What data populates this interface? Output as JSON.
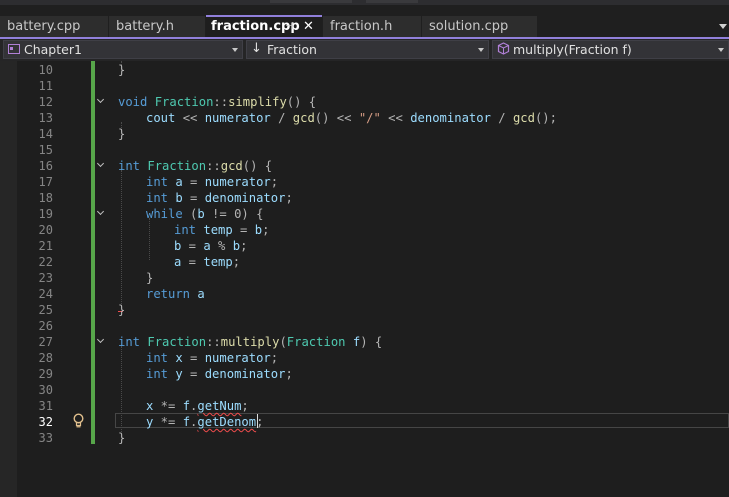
{
  "tabs": [
    {
      "label": "battery.cpp",
      "active": false
    },
    {
      "label": "battery.h",
      "active": false
    },
    {
      "label": "fraction.cpp",
      "active": true,
      "pin_icon": "pin-icon",
      "close_icon": "close-icon"
    },
    {
      "label": "fraction.h",
      "active": false
    },
    {
      "label": "solution.cpp",
      "active": false
    }
  ],
  "nav": {
    "project": "Chapter1",
    "scope": "Fraction",
    "member": "multiply(Fraction f)"
  },
  "editor": {
    "current_line": "32",
    "lines": [
      {
        "n": "10",
        "tokens": [
          {
            "t": "}",
            "c": "op"
          }
        ]
      },
      {
        "n": "11",
        "tokens": []
      },
      {
        "n": "12",
        "tokens": [
          {
            "t": "void",
            "c": "kw"
          },
          {
            "t": " ",
            "c": ""
          },
          {
            "t": "Fraction",
            "c": "cls"
          },
          {
            "t": "::",
            "c": "op"
          },
          {
            "t": "simplify",
            "c": "fn"
          },
          {
            "t": "() {",
            "c": "op"
          }
        ]
      },
      {
        "n": "13",
        "tokens": [
          {
            "t": "cout",
            "c": "var"
          },
          {
            "t": " << ",
            "c": "op"
          },
          {
            "t": "numerator",
            "c": "var"
          },
          {
            "t": " / ",
            "c": "op"
          },
          {
            "t": "gcd",
            "c": "fn"
          },
          {
            "t": "() << ",
            "c": "op"
          },
          {
            "t": "\"/\"",
            "c": "str"
          },
          {
            "t": " << ",
            "c": "op"
          },
          {
            "t": "denominator",
            "c": "var"
          },
          {
            "t": " / ",
            "c": "op"
          },
          {
            "t": "gcd",
            "c": "fn"
          },
          {
            "t": "();",
            "c": "op"
          }
        ]
      },
      {
        "n": "14",
        "tokens": [
          {
            "t": "}",
            "c": "op"
          }
        ]
      },
      {
        "n": "15",
        "tokens": []
      },
      {
        "n": "16",
        "tokens": [
          {
            "t": "int",
            "c": "kw"
          },
          {
            "t": " ",
            "c": ""
          },
          {
            "t": "Fraction",
            "c": "cls"
          },
          {
            "t": "::",
            "c": "op"
          },
          {
            "t": "gcd",
            "c": "fn"
          },
          {
            "t": "() {",
            "c": "op"
          }
        ]
      },
      {
        "n": "17",
        "tokens": [
          {
            "t": "int",
            "c": "kw"
          },
          {
            "t": " ",
            "c": ""
          },
          {
            "t": "a",
            "c": "var"
          },
          {
            "t": " = ",
            "c": "op"
          },
          {
            "t": "numerator",
            "c": "var"
          },
          {
            "t": ";",
            "c": "op"
          }
        ]
      },
      {
        "n": "18",
        "tokens": [
          {
            "t": "int",
            "c": "kw"
          },
          {
            "t": " ",
            "c": ""
          },
          {
            "t": "b",
            "c": "var"
          },
          {
            "t": " = ",
            "c": "op"
          },
          {
            "t": "denominator",
            "c": "var"
          },
          {
            "t": ";",
            "c": "op"
          }
        ]
      },
      {
        "n": "19",
        "tokens": [
          {
            "t": "while",
            "c": "kw"
          },
          {
            "t": " (",
            "c": "op"
          },
          {
            "t": "b",
            "c": "var"
          },
          {
            "t": " != 0) {",
            "c": "op"
          }
        ]
      },
      {
        "n": "20",
        "tokens": [
          {
            "t": "int",
            "c": "kw"
          },
          {
            "t": " ",
            "c": ""
          },
          {
            "t": "temp",
            "c": "var"
          },
          {
            "t": " = ",
            "c": "op"
          },
          {
            "t": "b",
            "c": "var"
          },
          {
            "t": ";",
            "c": "op"
          }
        ]
      },
      {
        "n": "21",
        "tokens": [
          {
            "t": "b",
            "c": "var"
          },
          {
            "t": " = ",
            "c": "op"
          },
          {
            "t": "a",
            "c": "var"
          },
          {
            "t": " % ",
            "c": "op"
          },
          {
            "t": "b",
            "c": "var"
          },
          {
            "t": ";",
            "c": "op"
          }
        ]
      },
      {
        "n": "22",
        "tokens": [
          {
            "t": "a",
            "c": "var"
          },
          {
            "t": " = ",
            "c": "op"
          },
          {
            "t": "temp",
            "c": "var"
          },
          {
            "t": ";",
            "c": "op"
          }
        ]
      },
      {
        "n": "23",
        "tokens": [
          {
            "t": "}",
            "c": "op"
          }
        ]
      },
      {
        "n": "24",
        "tokens": [
          {
            "t": "return",
            "c": "kw"
          },
          {
            "t": " ",
            "c": ""
          },
          {
            "t": "a",
            "c": "var"
          }
        ]
      },
      {
        "n": "25",
        "tokens": [
          {
            "t": "}",
            "c": "op"
          }
        ]
      },
      {
        "n": "26",
        "tokens": []
      },
      {
        "n": "27",
        "tokens": [
          {
            "t": "int",
            "c": "kw"
          },
          {
            "t": " ",
            "c": ""
          },
          {
            "t": "Fraction",
            "c": "cls"
          },
          {
            "t": "::",
            "c": "op"
          },
          {
            "t": "multiply",
            "c": "fn"
          },
          {
            "t": "(",
            "c": "op"
          },
          {
            "t": "Fraction",
            "c": "cls"
          },
          {
            "t": " ",
            "c": ""
          },
          {
            "t": "f",
            "c": "var"
          },
          {
            "t": ") {",
            "c": "op"
          }
        ]
      },
      {
        "n": "28",
        "tokens": [
          {
            "t": "int",
            "c": "kw"
          },
          {
            "t": " ",
            "c": ""
          },
          {
            "t": "x",
            "c": "var"
          },
          {
            "t": " = ",
            "c": "op"
          },
          {
            "t": "numerator",
            "c": "var"
          },
          {
            "t": ";",
            "c": "op"
          }
        ]
      },
      {
        "n": "29",
        "tokens": [
          {
            "t": "int",
            "c": "kw"
          },
          {
            "t": " ",
            "c": ""
          },
          {
            "t": "y",
            "c": "var"
          },
          {
            "t": " = ",
            "c": "op"
          },
          {
            "t": "denominator",
            "c": "var"
          },
          {
            "t": ";",
            "c": "op"
          }
        ]
      },
      {
        "n": "30",
        "tokens": []
      },
      {
        "n": "31",
        "tokens": [
          {
            "t": "x",
            "c": "var"
          },
          {
            "t": " *= ",
            "c": "op"
          },
          {
            "t": "f",
            "c": "var"
          },
          {
            "t": ".",
            "c": "op"
          },
          {
            "t": "getNum",
            "c": "var sq"
          },
          {
            "t": ";",
            "c": "op"
          }
        ]
      },
      {
        "n": "32",
        "tokens": [
          {
            "t": "y",
            "c": "var"
          },
          {
            "t": " *= ",
            "c": "op"
          },
          {
            "t": "f",
            "c": "var"
          },
          {
            "t": ".",
            "c": "op"
          },
          {
            "t": "getDenom",
            "c": "var sq"
          },
          {
            "t": ";",
            "c": "op"
          }
        ]
      },
      {
        "n": "33",
        "tokens": [
          {
            "t": "}",
            "c": "op"
          }
        ]
      }
    ]
  }
}
